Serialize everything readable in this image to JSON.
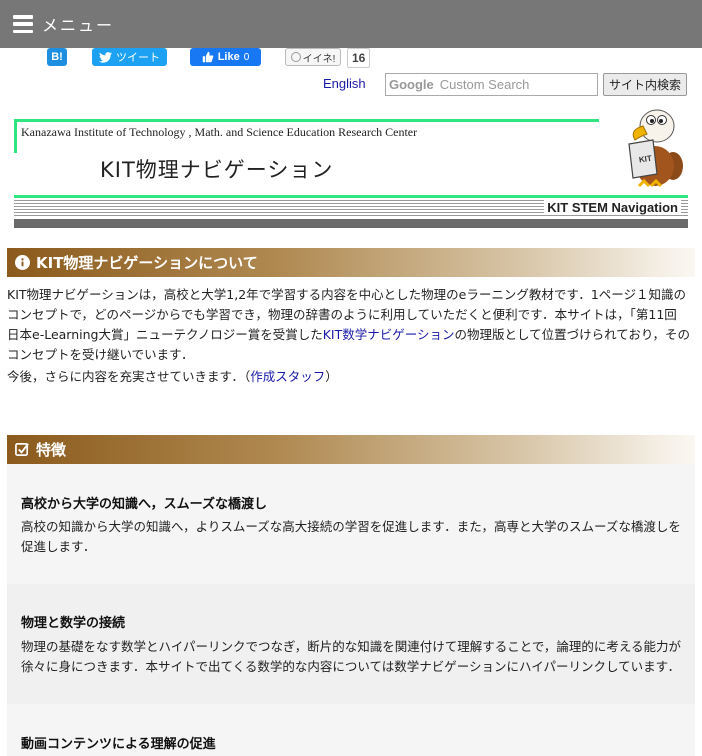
{
  "menu": {
    "label": "メニュー"
  },
  "share": {
    "hatena_label": "B!",
    "tweet_label": "ツイート",
    "like_label": "Like",
    "like_count": "0",
    "mixi_label": "イイネ!",
    "mixi_count": "16"
  },
  "topnav": {
    "english": "English",
    "search_brand": "Google",
    "search_placeholder": "Custom Search",
    "search_button": "サイト内検索"
  },
  "banner": {
    "institute": "Kanazawa Institute of Technology ,  Math. and Science Education Research Center",
    "title": "KIT物理ナビゲーション",
    "subtitle": "KIT STEM Navigation",
    "mascot_text": "KIT"
  },
  "about": {
    "heading": "KIT物理ナビゲーションについて",
    "p1_a": "KIT物理ナビゲーションは，高校と大学1,2年で学習する内容を中心とした物理のeラーニング教材です．1ページ１知識のコンセプトで，どのページからでも学習でき，物理の辞書のように利用していただくと便利です．本サイトは，「第11回 日本e-Learning大賞」ニューテクノロジー賞を受賞した",
    "p1_link": "KIT数学ナビゲーション",
    "p1_b": "の物理版として位置づけられており，そのコンセプトを受け継いでいます．",
    "p2_a": "今後，さらに内容を充実させていきます．（",
    "p2_link": "作成スタッフ",
    "p2_b": "）"
  },
  "features": {
    "heading": "特徴",
    "items": [
      {
        "title": "高校から大学の知識へ，スムーズな橋渡し",
        "body": "高校の知識から大学の知識へ，よりスムーズな高大接続の学習を促進します．また，高専と大学のスムーズな橋渡しを促進します．"
      },
      {
        "title": "物理と数学の接続",
        "body": "物理の基礎をなす数学とハイパーリンクでつなぎ，断片的な知識を関連付けて理解することで，論理的に考える能力が徐々に身につきます．本サイトで出てくる数学的な内容については数学ナビゲーションにハイパーリンクしています．"
      },
      {
        "title": "動画コンテンツによる理解の促進",
        "body": ""
      }
    ]
  },
  "colors": {
    "menubar": "#777777",
    "accent_green": "#2ee57f",
    "section_brown": "#8b5a1c",
    "link": "#1a1aa6"
  }
}
